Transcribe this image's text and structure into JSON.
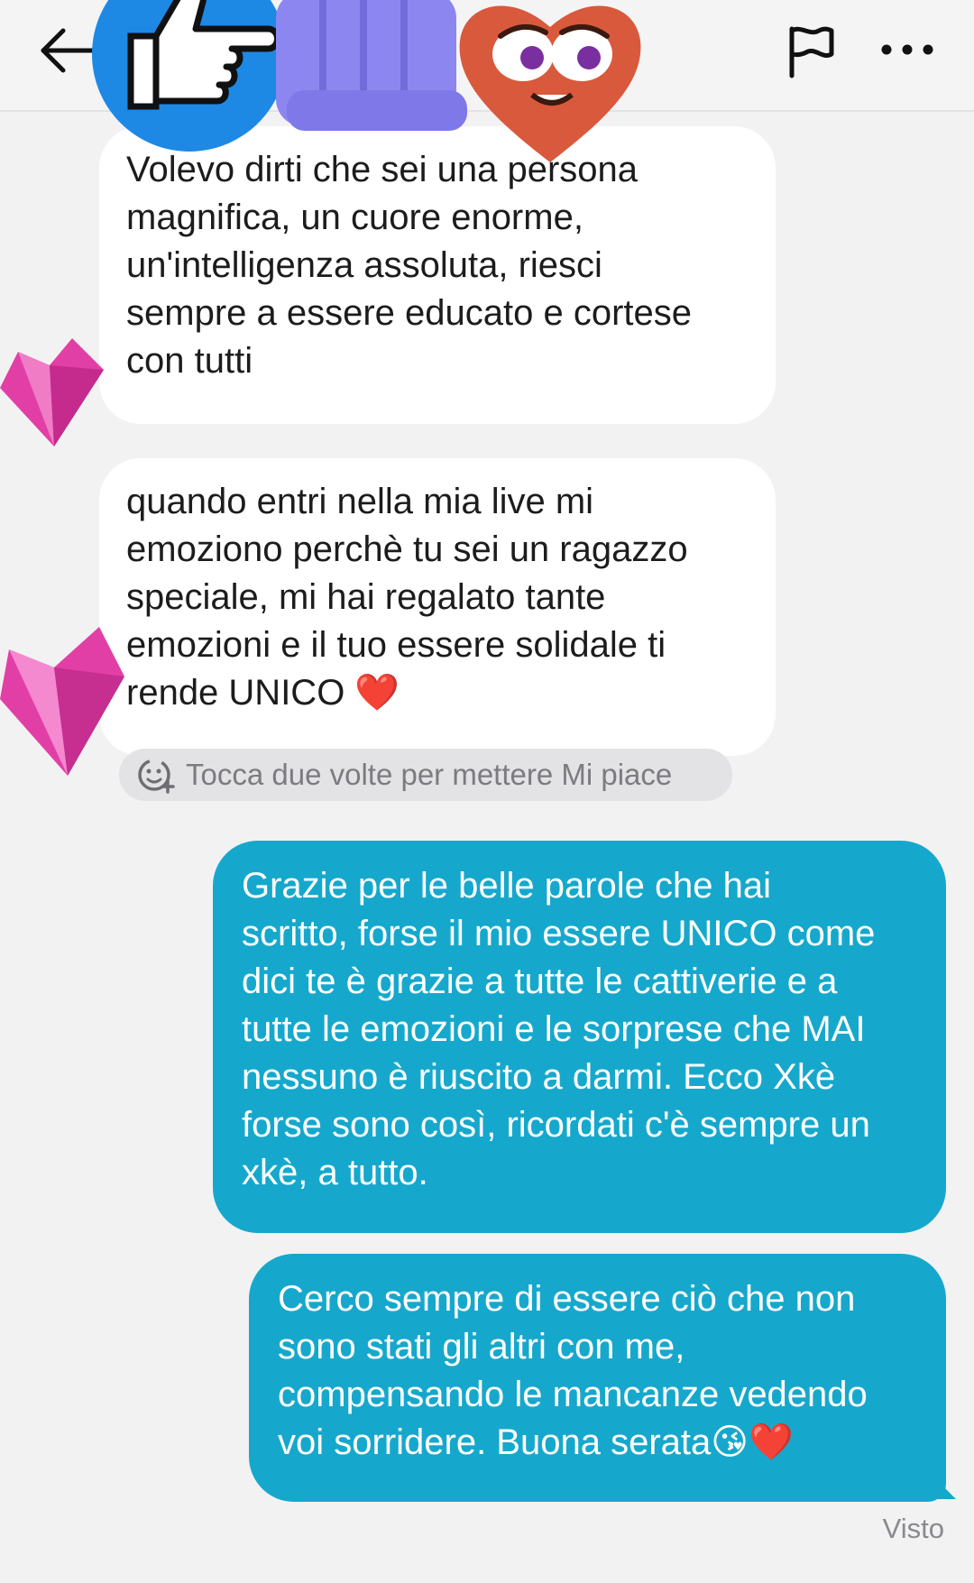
{
  "header": {
    "back_icon": "arrow-left-icon",
    "report_icon": "flag-icon",
    "more_icon": "more-horizontal-icon"
  },
  "stickers": [
    "thumbs-up-pointing-icon",
    "fist-bump-icon",
    "heart-face-icon",
    "pink-gem-heart-icon",
    "pink-gem-heart-icon"
  ],
  "messages": [
    {
      "direction": "incoming",
      "text": "Volevo dirti che sei una persona\nmagnifica, un cuore enorme,\nun'intelligenza assoluta, riesci\nsempre a essere educato e cortese\ncon tutti"
    },
    {
      "direction": "incoming",
      "text": "quando entri nella mia live mi\nemoziono perchè tu sei un ragazzo\nspeciale, mi hai regalato tante\nemozioni e il tuo essere solidale ti\nrende UNICO ❤️"
    },
    {
      "direction": "outgoing",
      "text": "Grazie per le belle parole che hai\nscritto, forse il mio essere UNICO come\ndici te è grazie a tutte le cattiverie e a\ntutte le emozioni e le sorprese che MAI\nnessuno è riuscito a darmi. Ecco Xkè\nforse sono così, ricordati c'è sempre un\nxkè, a tutto."
    },
    {
      "direction": "outgoing",
      "text": "Cerco sempre di essere ciò che non\nsono stati gli altri con me,\ncompensando le mancanze vedendo\nvoi sorridere. Buona serata😘❤️"
    }
  ],
  "like_hint": {
    "icon": "add-reaction-icon",
    "text": "Tocca due volte per mettere Mi piace"
  },
  "status": "Visto",
  "colors": {
    "outgoing_bubble": "#16a8cc",
    "incoming_bubble": "#ffffff",
    "background": "#f2f2f3"
  }
}
